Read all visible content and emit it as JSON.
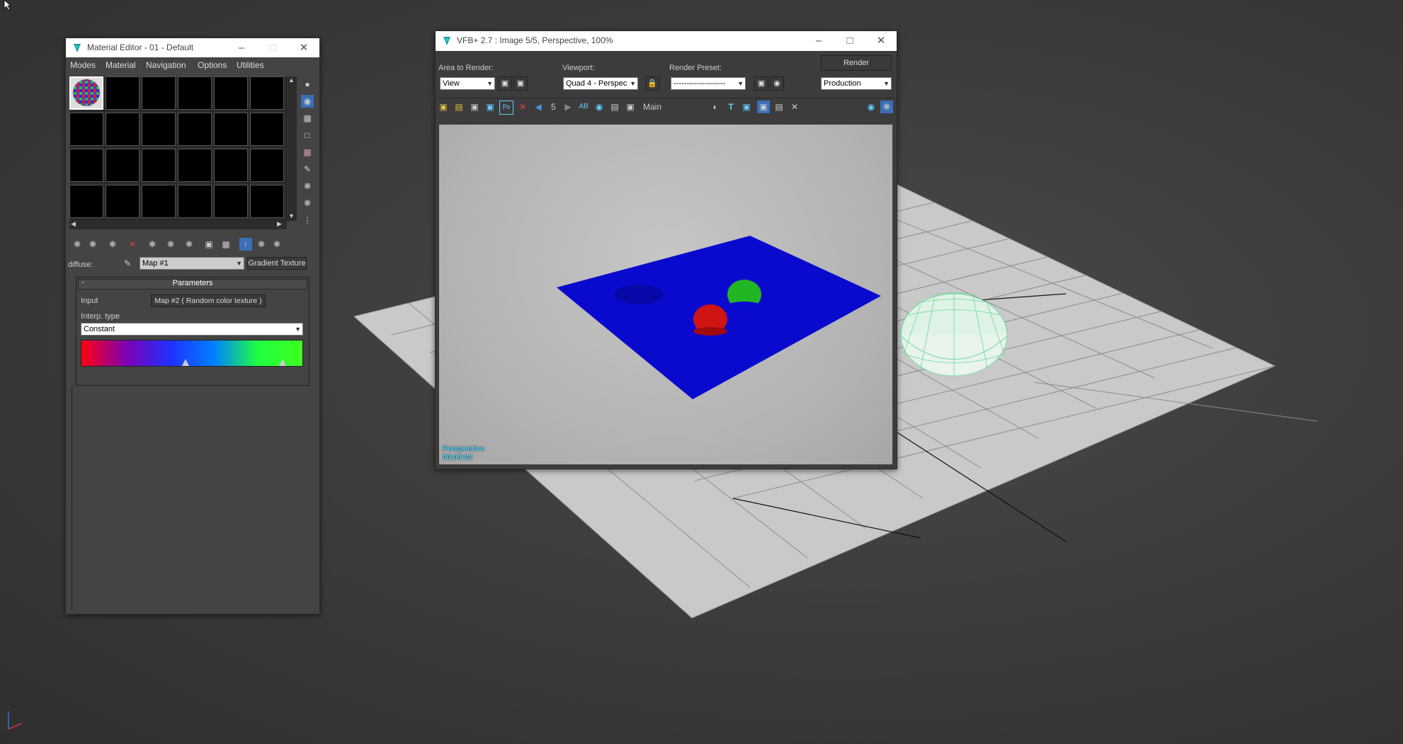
{
  "material_editor": {
    "title": "Material Editor - 01 - Default",
    "menu": [
      "Modes",
      "Material",
      "Navigation",
      "Options",
      "Utilities"
    ],
    "diffuse_label": "diffuse:",
    "map_dropdown": "Map #1",
    "map_type": "Gradient Texture",
    "rollout_toggle": "-",
    "rollout_title": "Parameters",
    "input_label": "Input",
    "input_value": "Map #2  ( Random color texture )",
    "interp_label": "Interp. type",
    "interp_value": "Constant",
    "gradient_colors": [
      "#ff0010",
      "#8000b0",
      "#2030ff",
      "#0080ff",
      "#20ff40",
      "#40ff20"
    ],
    "gradient_markers": [
      0.47,
      0.91
    ],
    "icons": {
      "side_tools": [
        "sphere-sample-icon",
        "backlight-icon",
        "checker-background-icon",
        "sample-uv-icon",
        "video-color-check-icon",
        "make-preview-icon",
        "options-icon",
        "select-by-material-icon",
        "material-map-navigator-icon"
      ],
      "bottom_tools": [
        "get-material-icon",
        "put-to-scene-icon",
        "assign-to-selection-icon",
        "delete-icon",
        "make-unique-icon",
        "put-to-library-icon",
        "material-id-channel-icon",
        "show-map-in-viewport-icon",
        "show-end-result-icon",
        "go-to-parent-icon",
        "go-forward-icon"
      ]
    }
  },
  "vfb": {
    "title": "VFB+ 2.7 : Image 5/5, Perspective, 100%",
    "area_label": "Area to Render:",
    "area_value": "View",
    "viewport_label": "Viewport:",
    "viewport_value": "Quad 4 - Perspec",
    "preset_label": "Render Preset:",
    "preset_value": "--------------------",
    "render_button": "Render",
    "production_value": "Production",
    "image_counter": "5",
    "channel_label": "Main",
    "overlay_view": "Perspective",
    "overlay_time": "00:00:02"
  }
}
